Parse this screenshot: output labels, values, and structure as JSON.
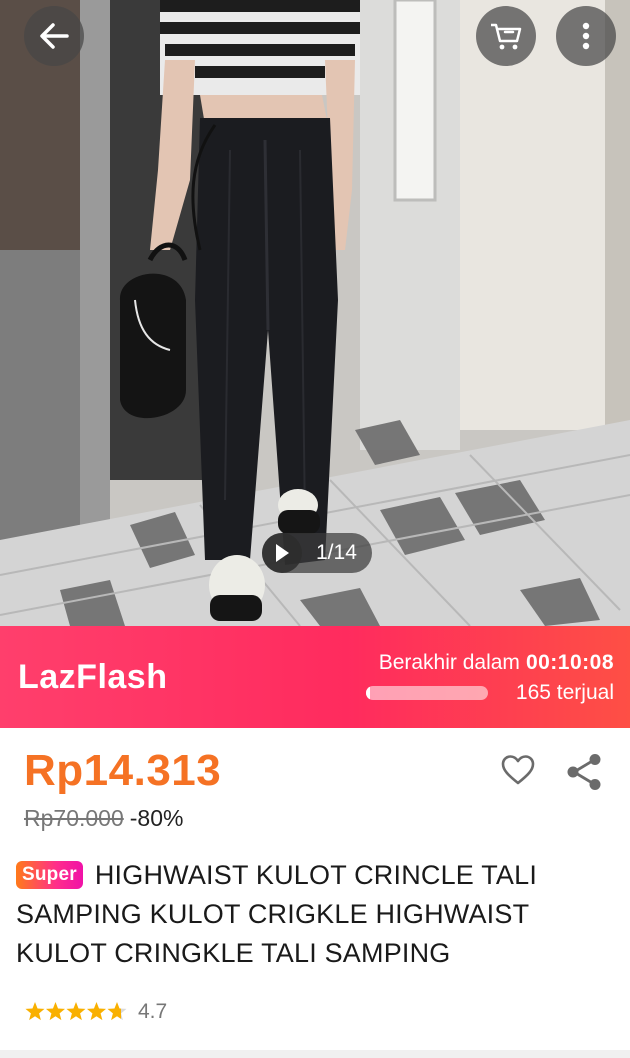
{
  "gallery": {
    "counter": "1/14",
    "current_image": 1,
    "total_images": 14
  },
  "top_buttons": {
    "back_icon": "arrow-left-icon",
    "cart_icon": "cart-icon",
    "more_icon": "more-vertical-icon"
  },
  "flash_sale": {
    "brand": "LazFlash",
    "ends_label": "Berakhir dalam",
    "countdown": "00:10:08",
    "sold_text": "165 terjual",
    "sold_progress": 0.03,
    "colors": {
      "start": "#ff3f6c",
      "end": "#fe4f45"
    }
  },
  "product": {
    "price": "Rp14.313",
    "original_price": "Rp70.000",
    "discount": "-80%",
    "badge": "Super",
    "title": "HIGHWAIST KULOT CRINCLE TALI SAMPING KULOT CRIGKLE HIGHWAIST KULOT CRINGKLE TALI SAMPING",
    "rating": "4.7",
    "rating_stars": 4.7,
    "accent_color": "#f57224",
    "star_color": "#f9b000"
  }
}
